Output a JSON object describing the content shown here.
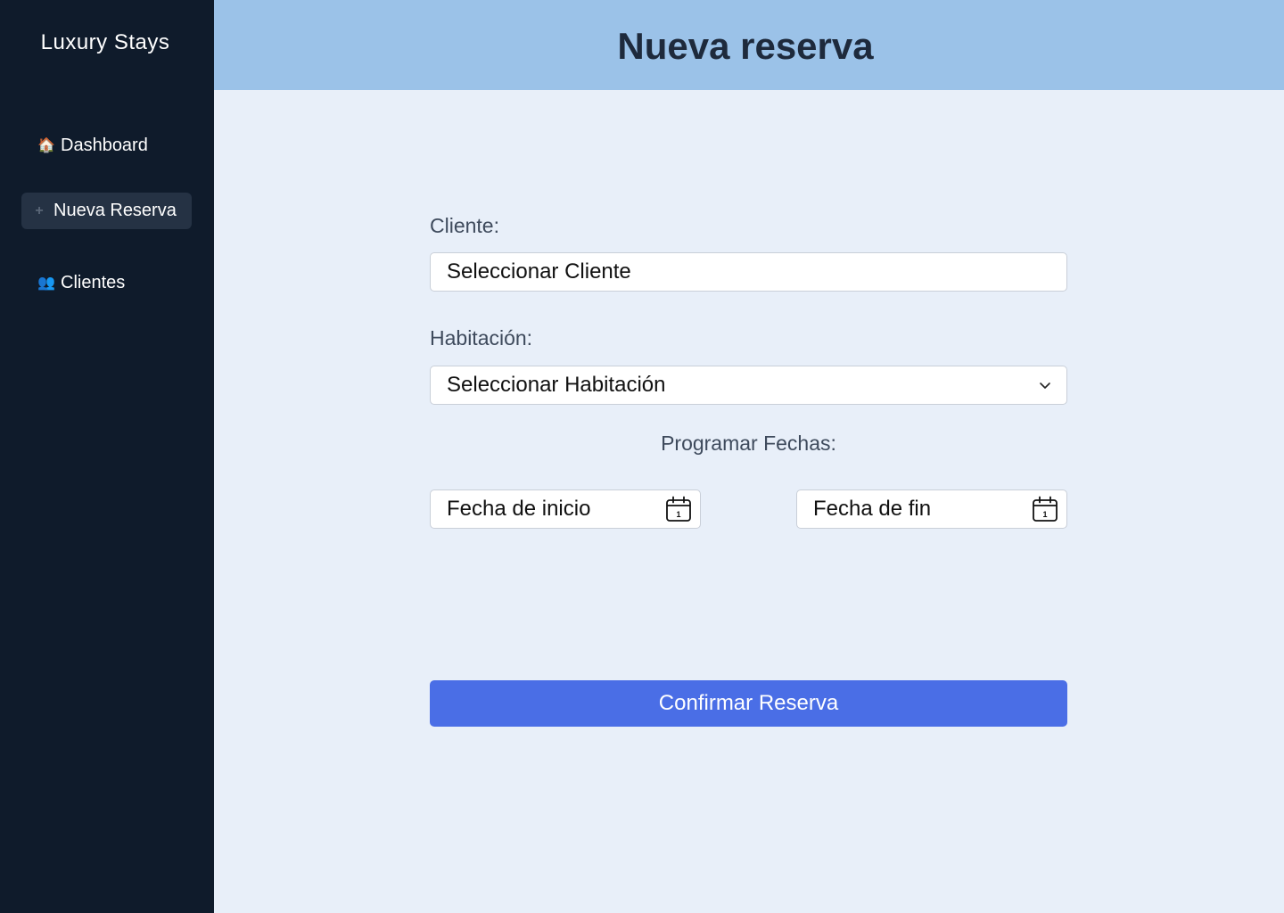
{
  "sidebar": {
    "brand": "Luxury Stays",
    "items": [
      {
        "icon": "house-icon",
        "glyph": "🏠",
        "label": "Dashboard"
      },
      {
        "icon": "plus-icon",
        "glyph": "+",
        "label": "Nueva Reserva",
        "active": true
      },
      {
        "icon": "users-icon",
        "glyph": "👥",
        "label": "Clientes"
      }
    ]
  },
  "header": {
    "title": "Nueva reserva"
  },
  "form": {
    "cliente_label": "Cliente:",
    "cliente_placeholder": "Seleccionar Cliente",
    "habitacion_label": "Habitación:",
    "habitacion_selected": "Seleccionar Habitación",
    "fechas_label": "Programar Fechas:",
    "fecha_inicio_placeholder": "Fecha de inicio",
    "fecha_fin_placeholder": "Fecha de fin",
    "calendar_day": "1",
    "confirm_label": "Confirmar Reserva"
  },
  "colors": {
    "sidebar_bg": "#0f1b2b",
    "header_bg": "#9bc2e8",
    "page_bg": "#e8eff9",
    "accent": "#4a6ee6"
  }
}
